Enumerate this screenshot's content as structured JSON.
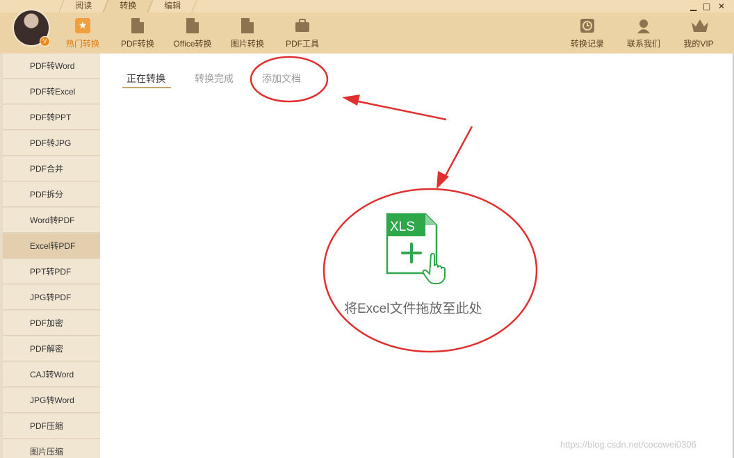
{
  "mode_tabs": [
    "阅读",
    "转换",
    "编辑"
  ],
  "toolbar": {
    "items": [
      "热门转换",
      "PDF转换",
      "Office转换",
      "图片转换",
      "PDF工具"
    ],
    "right_items": [
      "转换记录",
      "联系我们",
      "我的VIP"
    ],
    "active_color": "#e07a10"
  },
  "avatar_badge": "V",
  "window_controls": [
    "▁",
    "□",
    "✕"
  ],
  "sidebar": {
    "items": [
      "PDF转Word",
      "PDF转Excel",
      "PDF转PPT",
      "PDF转JPG",
      "PDF合并",
      "PDF拆分",
      "Word转PDF",
      "Excel转PDF",
      "PPT转PDF",
      "JPG转PDF",
      "PDF加密",
      "PDF解密",
      "CAJ转Word",
      "JPG转Word",
      "PDF压缩",
      "图片压缩"
    ],
    "active_index": 7
  },
  "content_tabs": [
    "正在转换",
    "转换完成",
    "添加文档"
  ],
  "drop_zone": {
    "file_badge": "XLS",
    "label": "将Excel文件拖放至此处",
    "icon": "xls-add-file-icon",
    "accent_color": "#2ea84b"
  },
  "watermark": "https://blog.csdn.net/cocowei0306",
  "annotation_color": "#e03030"
}
